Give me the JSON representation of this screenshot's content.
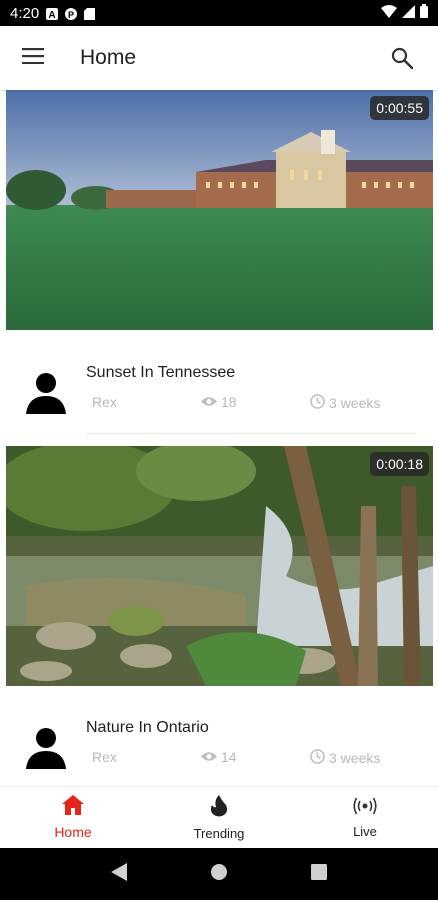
{
  "status_bar": {
    "time": "4:20",
    "left_icons": [
      "notification-a-icon",
      "notification-p-icon",
      "sd-card-icon"
    ],
    "right_icons": [
      "wifi-icon",
      "cellular-signal-icon",
      "battery-icon"
    ]
  },
  "app_bar": {
    "title": "Home",
    "menu_icon": "hamburger-menu-icon",
    "search_icon": "search-icon"
  },
  "videos": [
    {
      "title": "Sunset In Tennessee",
      "duration": "0:00:55",
      "author": "Rex",
      "views": "18",
      "age": "3 weeks"
    },
    {
      "title": "Nature In Ontario",
      "duration": "0:00:18",
      "author": "Rex",
      "views": "14",
      "age": "3 weeks"
    }
  ],
  "bottom_nav": {
    "items": [
      {
        "label": "Home",
        "icon": "home-icon",
        "active": true
      },
      {
        "label": "Trending",
        "icon": "flame-icon",
        "active": false
      },
      {
        "label": "Live",
        "icon": "broadcast-icon",
        "active": false
      }
    ]
  },
  "colors": {
    "accent": "#e8231c",
    "meta_text": "#b8b8b8"
  }
}
